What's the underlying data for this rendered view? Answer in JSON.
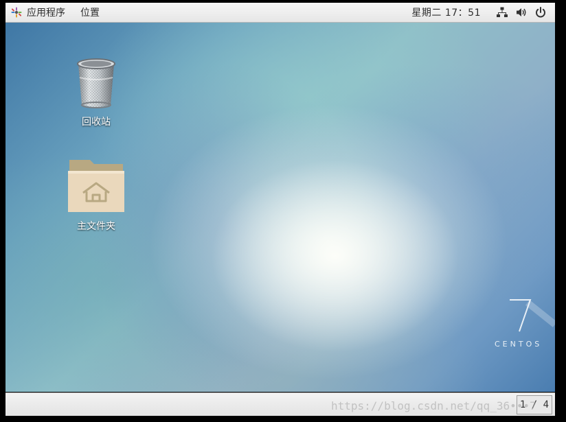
{
  "top_panel": {
    "apps_menu_label": "应用程序",
    "places_menu_label": "位置",
    "clock": "星期二 17：51",
    "icons": [
      "network-icon",
      "volume-icon",
      "power-icon"
    ]
  },
  "desktop": {
    "icons": [
      {
        "label": "回收站",
        "icon": "trash-icon"
      },
      {
        "label": "主文件夹",
        "icon": "home-folder-icon"
      }
    ],
    "brand": {
      "number": "7",
      "text": "CENTOS"
    }
  },
  "bottom_panel": {
    "workspace_indicator": "1 / 4"
  },
  "watermark": "https://blog.csdn.net/qq_36•••7"
}
